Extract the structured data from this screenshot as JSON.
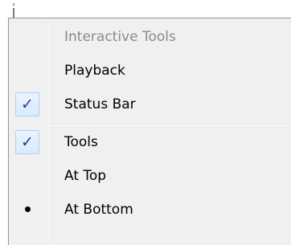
{
  "menu": {
    "items": [
      {
        "label": "Interactive Tools",
        "state": "disabled"
      },
      {
        "label": "Playback",
        "state": "normal"
      },
      {
        "label": "Status Bar",
        "state": "checked"
      },
      {
        "label": "Tools",
        "state": "checked"
      },
      {
        "label": "At Top",
        "state": "normal"
      },
      {
        "label": "At Bottom",
        "state": "radio-selected"
      }
    ],
    "check_glyph": "✓"
  },
  "colors": {
    "menu_background": "#f0f0f0",
    "disabled_text": "#8a8a8a",
    "check_color": "#1c3f94",
    "check_highlight_border": "#aecff7"
  },
  "icons": {
    "checked": "checkmark-icon",
    "radio": "bullet-icon"
  }
}
